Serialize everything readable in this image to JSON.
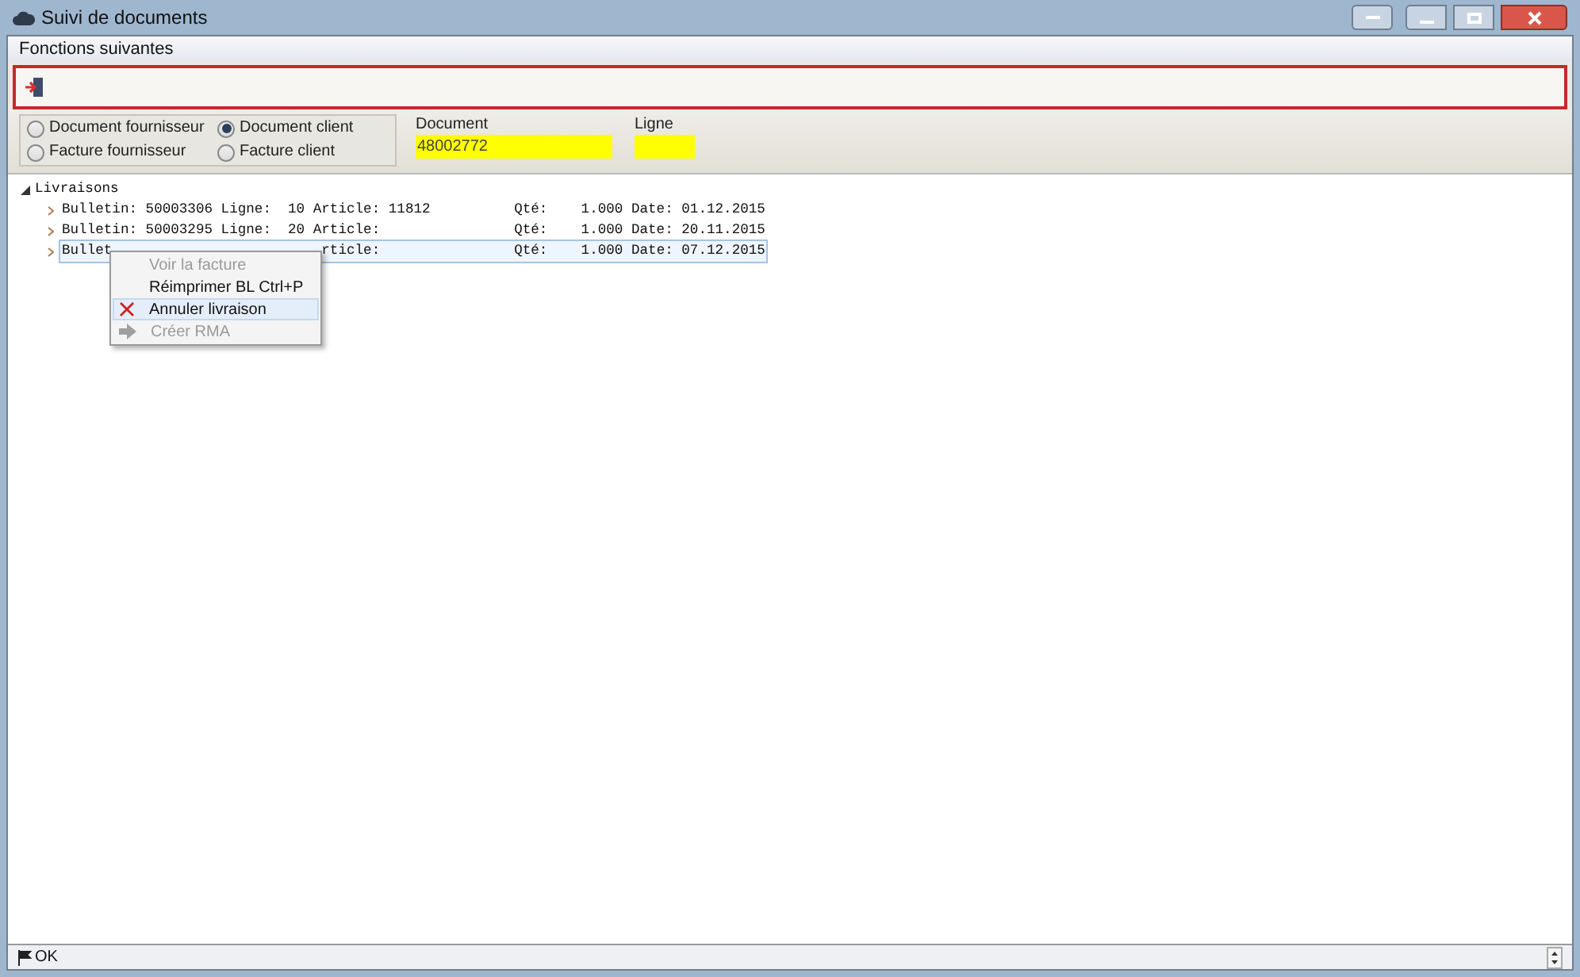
{
  "window": {
    "title": "Suivi de documents"
  },
  "menu_label": "Fonctions suivantes",
  "document_types": [
    {
      "label": "Document fournisseur",
      "selected": false
    },
    {
      "label": "Document client",
      "selected": true
    },
    {
      "label": "Facture fournisseur",
      "selected": false
    },
    {
      "label": "Facture client",
      "selected": false
    }
  ],
  "document_field": {
    "label": "Document",
    "value": "48002772"
  },
  "line_field": {
    "label": "Ligne"
  },
  "tree": {
    "label": "Livraisons",
    "expanded": true,
    "children": [
      {
        "text": "Bulletin: 50003306 Ligne:  10 Article: 11812          Qté:    1.000 Date: 01.12.2015",
        "selected": false
      },
      {
        "text": "Bulletin: 50003295 Ligne:  20 Article:                Qté:    1.000 Date: 20.11.2015",
        "selected": false
      },
      {
        "text_start": "Bullet",
        "text_end": "rticle:                Qté:    1.000 Date: 07.12.2015",
        "selected": true
      }
    ]
  },
  "context_menu": [
    {
      "label": "Voir la facture",
      "disabled": true,
      "highlighted": false,
      "kind": "plain"
    },
    {
      "label": "Réimprimer BL Ctrl+P",
      "disabled": false,
      "highlighted": false,
      "kind": "plain"
    },
    {
      "label": "Annuler livraison",
      "disabled": false,
      "highlighted": true,
      "kind": "cancel"
    },
    {
      "label": "Créer RMA",
      "disabled": true,
      "highlighted": false,
      "kind": "forward"
    }
  ],
  "status_bar": {
    "text": "OK"
  }
}
